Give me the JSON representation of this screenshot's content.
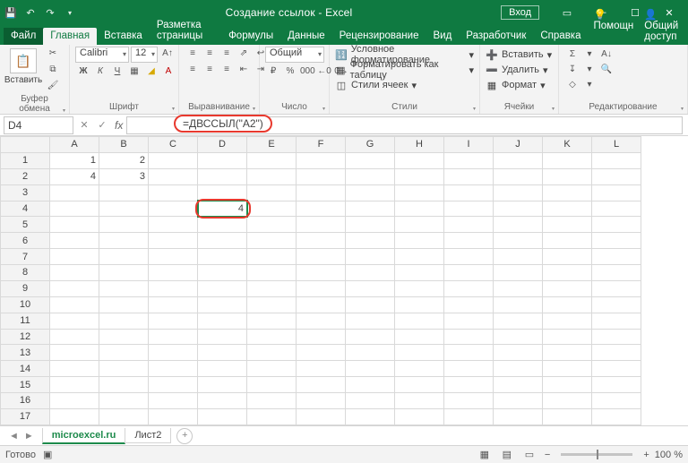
{
  "title": "Создание ссылок  -  Excel",
  "login": "Вход",
  "menu": {
    "file": "Файл",
    "tabs": [
      "Главная",
      "Вставка",
      "Разметка страницы",
      "Формулы",
      "Данные",
      "Рецензирование",
      "Вид",
      "Разработчик",
      "Справка"
    ],
    "active": 0,
    "help": "Помощн",
    "share": "Общий доступ"
  },
  "ribbon": {
    "clipboard": {
      "paste": "Вставить",
      "label": "Буфер обмена"
    },
    "font": {
      "name": "Calibri",
      "size": "12",
      "label": "Шрифт"
    },
    "align": {
      "label": "Выравнивание"
    },
    "number": {
      "format": "Общий",
      "label": "Число"
    },
    "styles": {
      "cond": "Условное форматирование",
      "table": "Форматировать как таблицу",
      "cells": "Стили ячеек",
      "label": "Стили"
    },
    "cells": {
      "insert": "Вставить",
      "delete": "Удалить",
      "format": "Формат",
      "label": "Ячейки"
    },
    "editing": {
      "label": "Редактирование"
    }
  },
  "formula": {
    "namebox": "D4",
    "value": "=ДВССЫЛ(\"A2\")"
  },
  "grid": {
    "cols": [
      "A",
      "B",
      "C",
      "D",
      "E",
      "F",
      "G",
      "H",
      "I",
      "J",
      "K",
      "L"
    ],
    "rows": 17,
    "data": {
      "A1": "1",
      "B1": "2",
      "A2": "4",
      "B2": "3",
      "D4": "4"
    },
    "selected": "D4"
  },
  "sheets": {
    "tabs": [
      "microexcel.ru",
      "Лист2"
    ],
    "active": 0
  },
  "status": {
    "ready": "Готово",
    "zoom": "100 %"
  }
}
